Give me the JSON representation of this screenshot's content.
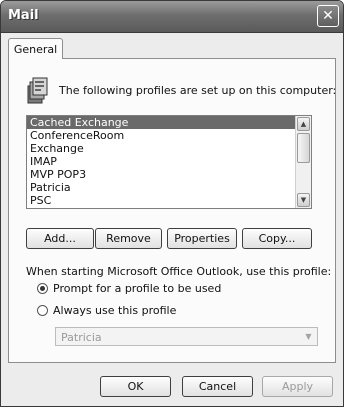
{
  "window": {
    "title": "Mail"
  },
  "tabs": [
    {
      "label": "General"
    }
  ],
  "intro_text": "The following profiles are set up on this computer:",
  "profiles": {
    "items": [
      "Cached Exchange",
      "ConferenceRoom",
      "Exchange",
      "IMAP",
      "MVP POP3",
      "Patricia",
      "PSC"
    ],
    "selected": "Cached Exchange"
  },
  "profile_buttons": {
    "add": "Add...",
    "remove": "Remove",
    "properties": "Properties",
    "copy": "Copy..."
  },
  "startup": {
    "label": "When starting Microsoft Office Outlook, use this profile:",
    "option_prompt": "Prompt for a profile to be used",
    "option_always": "Always use this profile",
    "selected_option": "prompt",
    "default_profile": "Patricia"
  },
  "footer_buttons": {
    "ok": "OK",
    "cancel": "Cancel",
    "apply": "Apply"
  },
  "icons": {
    "close": "close-icon",
    "profiles": "profiles-icon",
    "scroll_up": "scroll-up-arrow-icon",
    "scroll_down": "scroll-down-arrow-icon",
    "dropdown": "chevron-down-icon"
  }
}
